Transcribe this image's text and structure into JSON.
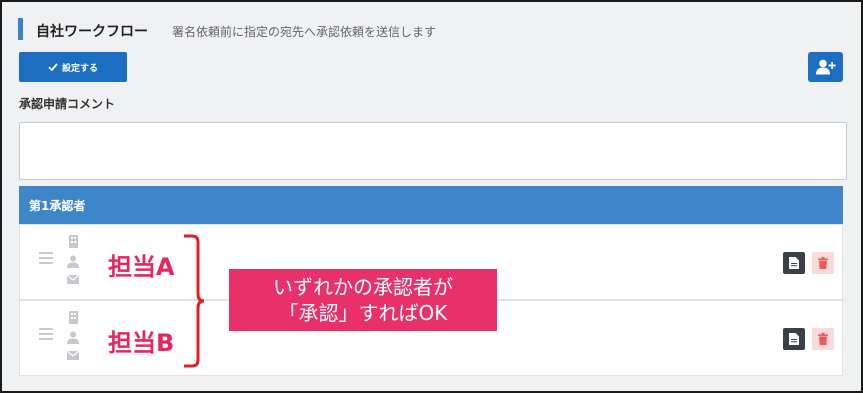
{
  "header": {
    "title": "自社ワークフロー",
    "subtitle": "署名依頼前に指定の宛先へ承認依頼を送信します"
  },
  "toolbar": {
    "set_label": "設定する",
    "add_user_icon": "user-plus-icon"
  },
  "comment": {
    "label": "承認申請コメント",
    "value": ""
  },
  "approvers": {
    "title": "第1承認者",
    "rows": [
      {
        "name": "担当A"
      },
      {
        "name": "担当B"
      }
    ]
  },
  "annotation": {
    "line1": "いずれかの承認者が",
    "line2": "「承認」すればOK"
  },
  "colors": {
    "accent": "#3b84c8",
    "button": "#1b6ec2",
    "panel_header": "#3f86c9",
    "highlight": "#e8265e"
  }
}
